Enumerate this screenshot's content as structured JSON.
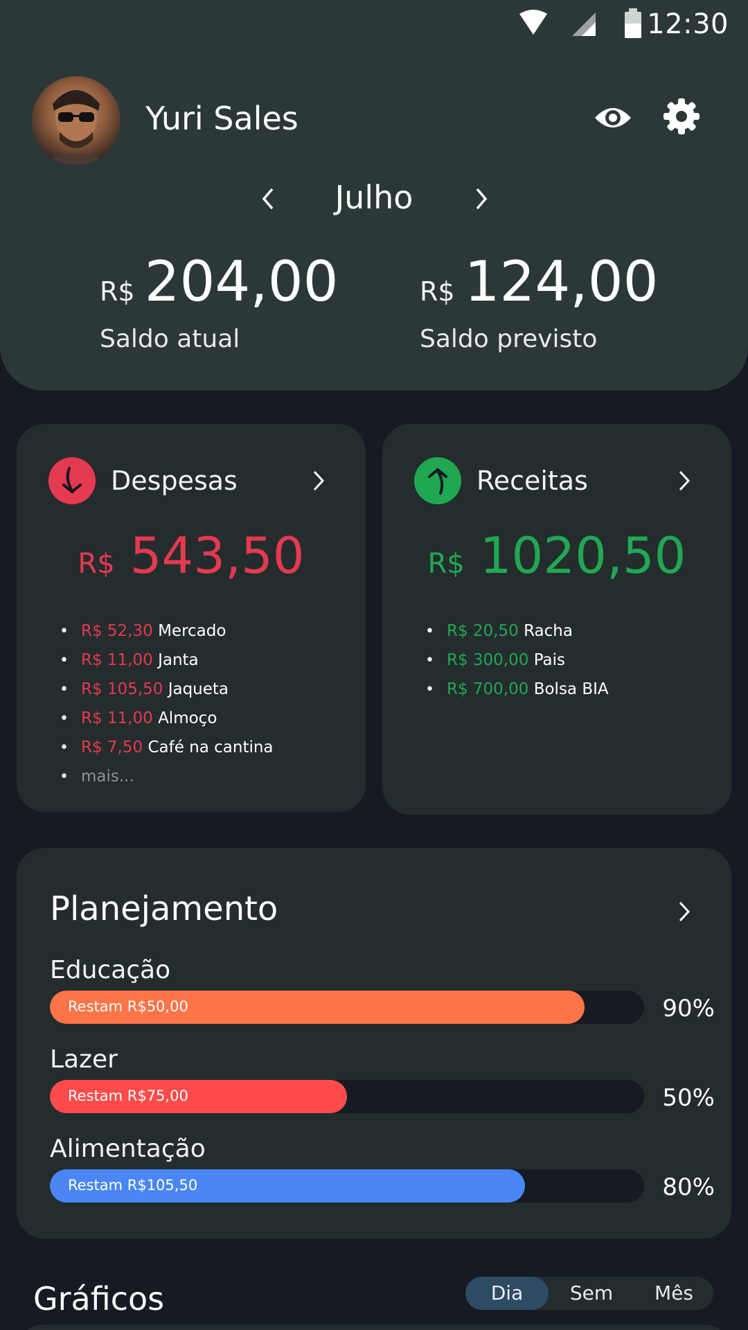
{
  "status_bar": {
    "time": "12:30",
    "icons": [
      "wifi-icon",
      "signal-icon",
      "battery-icon"
    ]
  },
  "header": {
    "user_name": "Yuri Sales",
    "month": "Julho",
    "icons": [
      "eye-icon",
      "gear-icon",
      "chevron-left-icon",
      "chevron-right-icon"
    ],
    "balance_current": {
      "currency": "R$",
      "value": "204,00",
      "label": "Saldo atual"
    },
    "balance_forecast": {
      "currency": "R$",
      "value": "124,00",
      "label": "Saldo previsto"
    }
  },
  "expenses": {
    "title": "Despesas",
    "currency": "R$",
    "total": "543,50",
    "color": "#e5394f",
    "items": [
      {
        "amount": "R$ 52,30",
        "desc": "Mercado"
      },
      {
        "amount": "R$ 11,00",
        "desc": "Janta"
      },
      {
        "amount": "R$ 105,50",
        "desc": "Jaqueta"
      },
      {
        "amount": "R$ 11,00",
        "desc": "Almoço"
      },
      {
        "amount": "R$ 7,50",
        "desc": "Café na cantina"
      }
    ],
    "more": "mais..."
  },
  "income": {
    "title": "Receitas",
    "currency": "R$",
    "total": "1020,50",
    "color": "#21a752",
    "items": [
      {
        "amount": "R$ 20,50",
        "desc": "Racha"
      },
      {
        "amount": "R$ 300,00",
        "desc": "Pais"
      },
      {
        "amount": "R$ 700,00",
        "desc": "Bolsa BIA"
      }
    ]
  },
  "planning": {
    "title": "Planejamento",
    "categories": [
      {
        "name": "Educação",
        "remaining": "Restam R$50,00",
        "percent_label": "90%",
        "fill": 0.9,
        "color": "#ff7448"
      },
      {
        "name": "Lazer",
        "remaining": "Restam R$75,00",
        "percent_label": "50%",
        "fill": 0.5,
        "color": "#ff4b4b"
      },
      {
        "name": "Alimentação",
        "remaining": "Restam R$105,50",
        "percent_label": "80%",
        "fill": 0.8,
        "color": "#4a86f5"
      }
    ]
  },
  "charts": {
    "title": "Gráficos",
    "periods": [
      "Dia",
      "Sem",
      "Mês"
    ],
    "active_period": "Dia"
  }
}
